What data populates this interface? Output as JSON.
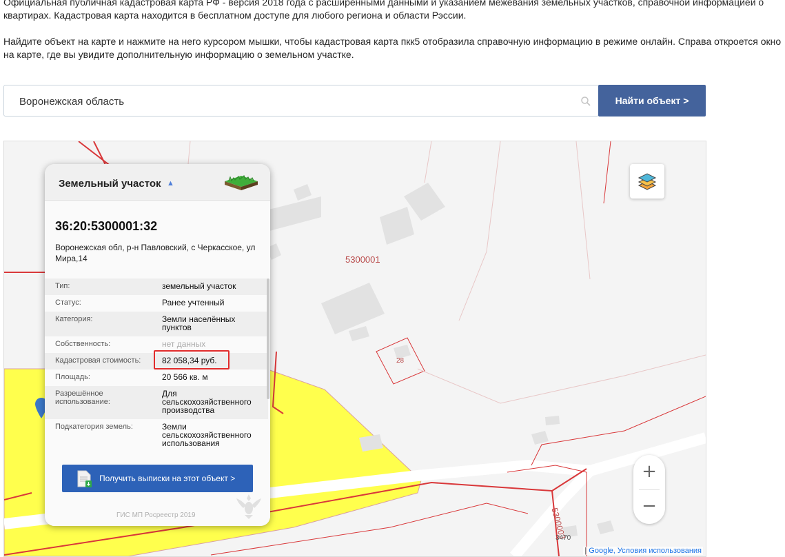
{
  "intro": {
    "paragraph1": "Официальная публичная кадастровая карта РФ - версия 2018 года с расширенными данными и указанием межевания земельных участков, справочной информацией о квартирах. Кадастровая карта находится в бесплатном доступе для любого региона и области Рэссии.",
    "paragraph2": "Найдите объект на карте и нажмите на него курсором мышки, чтобы кадастровая карта пкк5 отобразила справочную информацию в режиме онлайн. Справа откроется окно на карте, где вы увидите дополнительную информацию о земельном участке."
  },
  "search": {
    "value": "Воронежская область",
    "button_label": "Найти объект >",
    "icon": "search-icon"
  },
  "map": {
    "labels": {
      "block": "5300001",
      "parcel": "28",
      "block2": "5300003",
      "parcel2": "3470"
    },
    "attribution": {
      "google": "Google",
      "separator": "|",
      "terms": "Условия использования"
    },
    "zoom_in": "+",
    "zoom_out": "−",
    "colors": {
      "parcel_fill": "#ffff4d",
      "boundary": "#d9383a",
      "building": "#e2e2e2",
      "road": "#ffffff"
    }
  },
  "card": {
    "title": "Земельный участок",
    "cadastral_number": "36:20:5300001:32",
    "address": "Воронежская обл, р-н Павловский, с Черкасское, ул Мира,14",
    "properties": [
      {
        "label": "Тип:",
        "value": "земельный участок"
      },
      {
        "label": "Статус:",
        "value": "Ранее учтенный"
      },
      {
        "label": "Категория:",
        "value": "Земли населённых пунктов"
      },
      {
        "label": "Собственность:",
        "value": "нет данных"
      },
      {
        "label": "Кадастровая стоимость:",
        "value": "82 058,34 руб."
      },
      {
        "label": "Площадь:",
        "value": "20 566 кв. м"
      },
      {
        "label": "Разрешённое использование:",
        "value": "Для сельскохозяйственного производства"
      },
      {
        "label": "Подкатегория земель:",
        "value": "Земли сельскохозяйственного использования"
      }
    ],
    "extract_button": "Получить выписки на этот объект >",
    "footer": "ГИС МП Росреестр 2019"
  }
}
